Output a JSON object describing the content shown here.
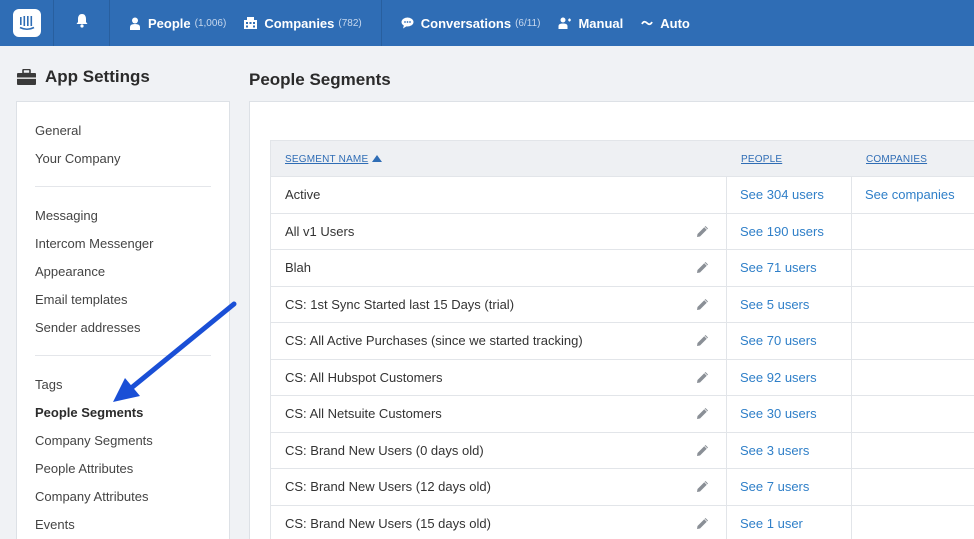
{
  "topbar": {
    "logo_icon": "intercom-logo-icon",
    "bell_icon": "bell-icon",
    "nav": [
      {
        "label": "People",
        "count": "(1,006)",
        "icon": "person-icon"
      },
      {
        "label": "Companies",
        "count": "(782)",
        "icon": "building-icon"
      }
    ],
    "nav2": [
      {
        "label": "Conversations",
        "count": "(6/11)",
        "icon": "chat-bubble-icon"
      },
      {
        "label": "Manual",
        "count": "",
        "icon": "manual-message-icon"
      },
      {
        "label": "Auto",
        "count": "",
        "icon": "auto-message-icon"
      }
    ]
  },
  "sidebar": {
    "title": "App Settings",
    "icon": "briefcase-icon",
    "items": [
      "General",
      "Your Company",
      "Messaging",
      "Intercom Messenger",
      "Appearance",
      "Email templates",
      "Sender addresses",
      "Tags",
      "People Segments",
      "Company Segments",
      "People Attributes",
      "Company Attributes",
      "Events"
    ],
    "active": "People Segments"
  },
  "main": {
    "title": "People Segments",
    "columns": {
      "name": "SEGMENT NAME",
      "people": "PEOPLE",
      "companies": "COMPANIES"
    },
    "rows": [
      {
        "name": "Active",
        "people": "See 304 users",
        "companies": "See companies",
        "editable": false
      },
      {
        "name": "All v1 Users",
        "people": "See 190 users",
        "companies": "",
        "editable": true
      },
      {
        "name": "Blah",
        "people": "See 71 users",
        "companies": "",
        "editable": true
      },
      {
        "name": "CS: 1st Sync Started last 15 Days (trial)",
        "people": "See 5 users",
        "companies": "",
        "editable": true
      },
      {
        "name": "CS: All Active Purchases (since we started tracking)",
        "people": "See 70 users",
        "companies": "",
        "editable": true
      },
      {
        "name": "CS: All Hubspot Customers",
        "people": "See 92 users",
        "companies": "",
        "editable": true
      },
      {
        "name": "CS: All Netsuite Customers",
        "people": "See 30 users",
        "companies": "",
        "editable": true
      },
      {
        "name": "CS: Brand New Users (0 days old)",
        "people": "See 3 users",
        "companies": "",
        "editable": true
      },
      {
        "name": "CS: Brand New Users (12 days old)",
        "people": "See 7 users",
        "companies": "",
        "editable": true
      },
      {
        "name": "CS: Brand New Users (15 days old)",
        "people": "See 1 user",
        "companies": "",
        "editable": true
      }
    ]
  },
  "annotation": {
    "color": "#1a4fd6",
    "icon": "pointer-arrow"
  }
}
